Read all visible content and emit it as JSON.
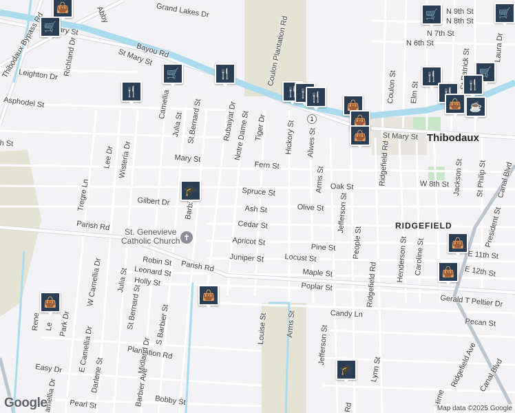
{
  "map": {
    "place_labels": {
      "thibodaux": "Thibodaux",
      "ridgefield": "RIDGEFIELD",
      "church": "St. Genevieve\nCatholic Church"
    },
    "streets": {
      "n9th": "N 9th St",
      "n8th": "N 8th St",
      "n7th": "N 7th St",
      "n6th": "N 6th St",
      "abby": "Abby",
      "grand_lakes": "Grand Lakes Dr",
      "ary": "ary St",
      "bayou_rd": "Bayou Rd",
      "st_mary_top": "St Mary St",
      "coulon_plantation": "Coulon Plantation Rd",
      "thibodaux_bypass": "Thibodaux Bypass Rd",
      "richland": "Richland Dr",
      "leighton": "Leighton Dr",
      "asphodel": "Asphodel St",
      "h_st": "h St",
      "camellia": "Camellia",
      "julia_top": "Julia St",
      "st_bernard_top": "St Bernard St",
      "rubaiyat": "Rubaiyat Dr",
      "notre_dame": "Notre Dame St",
      "tiger": "Tiger Dr",
      "hickory": "Hickory St",
      "alwes": "Alwes St",
      "coulon_st": "Coulon St",
      "elm": "Elm St",
      "st_patrick": "St Patrick St",
      "laura": "Laura Dr",
      "st_mary_right": "St Mary St",
      "lee": "Lee Dr",
      "wisteria": "Wisteria Dr",
      "mary": "Mary St",
      "fern": "Fern St",
      "arms_top": "Arms St",
      "oak": "Oak St",
      "w8th": "W 8th St",
      "ridgefield_top": "Ridgefield Rd",
      "jackson": "Jackson St",
      "st_philip": "St Philip St",
      "canal_top": "Canal Blvd",
      "tregre": "Tregre Ln",
      "gilbert": "Gilbert Dr",
      "spruce": "Spruce St",
      "ash": "Ash St",
      "olive": "Olive St",
      "jefferson_top": "Jefferson St",
      "parish_rd_left": "Parish Rd",
      "barbier": "Barbi",
      "cedar": "Cedar St",
      "apricot": "Apricot St",
      "pine": "Pine St",
      "people": "People St",
      "president": "President St",
      "e11th": "E 11th St",
      "juniper": "Juniper St",
      "locust": "Locust St",
      "robin": "Robin St",
      "parish_rd_mid": "Parish Rd",
      "leonard": "Leonard St",
      "holly": "Holly St",
      "maple": "Maple St",
      "henderson": "Henderson St",
      "caroline": "Caroline St",
      "e12th": "E 12th St",
      "poplar": "Poplar St",
      "ridgefield_mid": "Ridgefield Rd",
      "gerald_peltier": "Gerald T Peltier Dr",
      "w_camellia": "W Camellia Dr",
      "julia_bottom": "Julia St",
      "st_bernard_bottom": "St Bernard St",
      "s_barbier": "S Barbier St",
      "candy": "Candy Ln",
      "pecan": "Pecan St",
      "louise": "Louise St",
      "arms_bottom": "Arms St",
      "jefferson_bottom": "Jefferson St",
      "rene": "Rene",
      "le": "Le",
      "park": "Park Dr",
      "e_camellia": "E Camellia Dr",
      "plantation": "Plantation Rd",
      "midland": "Midland Dr",
      "ridgefield_ave": "Ridgefield Ave",
      "canal_bottom": "Canal Blvd",
      "easy": "Easy Dr",
      "darlene": "Darlene St",
      "lynn": "Lynn St",
      "barbier_ave": "Barbier Ave",
      "pearl": "Pearl St",
      "bobby": "Bobby St",
      "camellia_bottom": "amellia Dr",
      "rd_bottom": "Rd",
      "hime": "Hime"
    },
    "route_shield": "1",
    "logo": "Google",
    "attribution": "Map data ©2025 Google",
    "colors": {
      "background": "#f3f2f4",
      "road": "#ffffff",
      "road_casing": "#d5d8de",
      "highway": "#bcc5ce",
      "water": "#a9dbef",
      "field": "#e5e3d4",
      "park": "#c8e7c8",
      "pin": "#2a3f56"
    },
    "pins": [
      {
        "kind": "shopping-bag",
        "glyph": "👜"
      },
      {
        "kind": "shopping-cart",
        "glyph": "🛒"
      },
      {
        "kind": "shopping-cart",
        "glyph": "🛒"
      },
      {
        "kind": "shopping-cart",
        "glyph": "🛒"
      },
      {
        "kind": "restaurant",
        "glyph": "🍴"
      },
      {
        "kind": "restaurant",
        "glyph": "🍴"
      },
      {
        "kind": "restaurant",
        "glyph": "🍴"
      },
      {
        "kind": "restaurant",
        "glyph": "🍴"
      },
      {
        "kind": "restaurant",
        "glyph": "🍴"
      },
      {
        "kind": "shopping-bag",
        "glyph": "👜"
      },
      {
        "kind": "shopping-bag",
        "glyph": "👜"
      },
      {
        "kind": "shopping-bag",
        "glyph": "👜"
      },
      {
        "kind": "school",
        "glyph": "🎓"
      },
      {
        "kind": "shopping-bag",
        "glyph": "👜"
      },
      {
        "kind": "shopping-bag",
        "glyph": "👜"
      },
      {
        "kind": "shopping-bag",
        "glyph": "👜"
      },
      {
        "kind": "school",
        "glyph": "🎓"
      },
      {
        "kind": "restaurant",
        "glyph": "🍴"
      },
      {
        "kind": "shopping-cart",
        "glyph": "🛒"
      },
      {
        "kind": "restaurant",
        "glyph": "🍴"
      },
      {
        "kind": "restaurant",
        "glyph": "🍴"
      },
      {
        "kind": "shopping-bag",
        "glyph": "👜"
      },
      {
        "kind": "cafe",
        "glyph": "☕"
      },
      {
        "kind": "shopping-bag",
        "glyph": "👜"
      },
      {
        "kind": "shopping-cart",
        "glyph": "🛒"
      }
    ]
  }
}
